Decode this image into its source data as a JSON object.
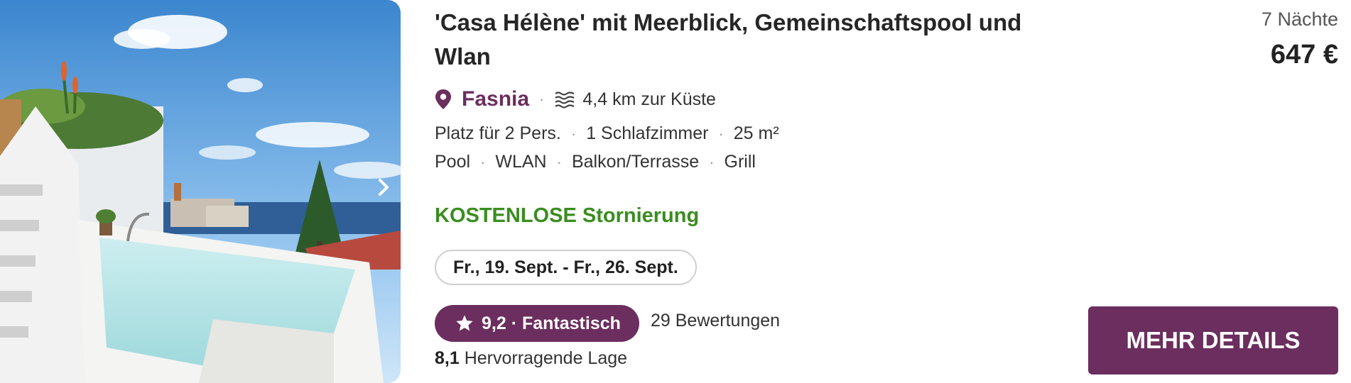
{
  "listing": {
    "title": "'Casa Hélène' mit Meerblick, Gemeinschaftspool und Wlan",
    "location": "Fasnia",
    "coast_distance": "4,4 km zur Küste",
    "specs": [
      "Platz für 2 Pers.",
      "1 Schlafzimmer",
      "25 m²"
    ],
    "amenities": [
      "Pool",
      "WLAN",
      "Balkon/Terrasse",
      "Grill"
    ],
    "cancellation": "KOSTENLOSE Stornierung",
    "dates": "Fr., 19. Sept. - Fr., 26. Sept.",
    "rating_label": "9,2 · Fantastisch",
    "reviews": "29 Bewertungen",
    "location_score": "8,1",
    "location_score_label": "Hervorragende Lage",
    "nights": "7 Nächte",
    "price": "647 €",
    "cta_label": "MEHR DETAILS"
  },
  "icons": {
    "photo_next": "chevron-right-icon",
    "location": "map-pin-icon",
    "coast": "waves-icon",
    "rating": "star-icon"
  },
  "colors": {
    "brand": "#6b2e5e",
    "cancellation": "#3a8d1f",
    "separator": "#999999"
  }
}
